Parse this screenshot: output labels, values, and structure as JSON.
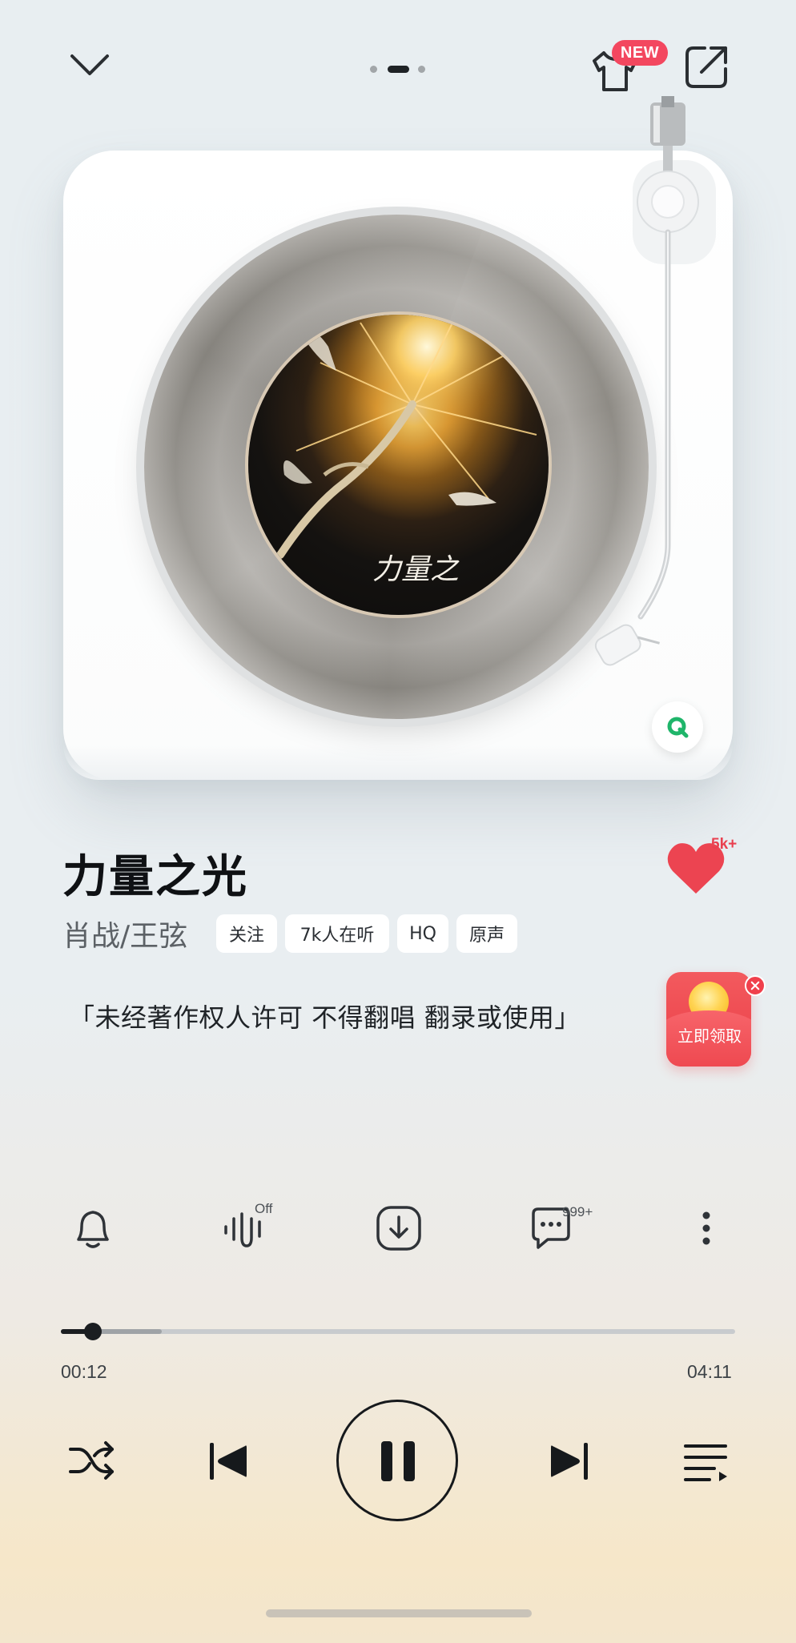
{
  "top_bar": {
    "collapse_icon": "chevron-down-icon",
    "pager_icon": "page-indicator",
    "skin_icon": "tshirt-icon",
    "new_badge": "NEW",
    "share_icon": "share-icon"
  },
  "player": {
    "album_label_text": "力量之",
    "badge_icon": "qq-music-logo"
  },
  "song": {
    "title": "力量之光",
    "artist": "肖战/王弦",
    "likes": "5k+",
    "tags": [
      "关注",
      "7k人在听",
      "HQ",
      "原声"
    ],
    "lyric": "「未经著作权人许可 不得翻唱 翻录或使用」"
  },
  "promo": {
    "label": "立即领取"
  },
  "actions": {
    "effect_state": "Off",
    "comment_count": "999+",
    "icons": [
      "bell-icon",
      "sound-effect-icon",
      "download-icon",
      "comment-icon",
      "more-icon"
    ]
  },
  "progress": {
    "current": "00:12",
    "total": "04:11",
    "played_fraction": 0.048,
    "buffered_fraction": 0.15
  },
  "controls": {
    "icons": [
      "shuffle-icon",
      "previous-icon",
      "pause-icon",
      "next-icon",
      "playlist-icon"
    ]
  },
  "colors": {
    "accent_red": "#f3475f",
    "heart_red": "#e9404f",
    "text_dark": "#0f1114"
  }
}
